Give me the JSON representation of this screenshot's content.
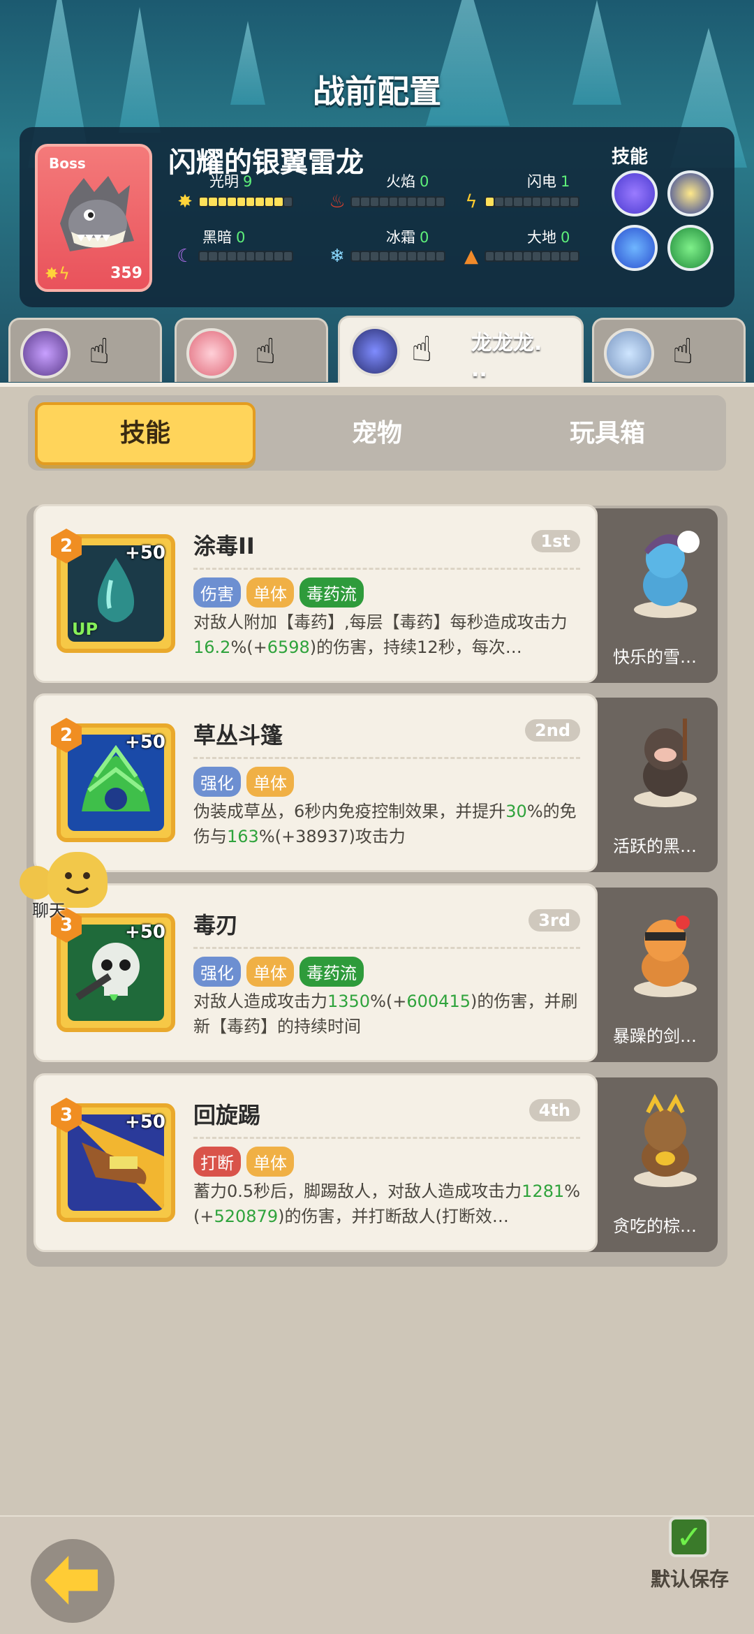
{
  "header": {
    "title": "战前配置"
  },
  "boss": {
    "tag": "Boss",
    "name": "闪耀的银翼雷龙",
    "level": "359",
    "elements": [
      {
        "label": "光明",
        "value": "9",
        "icon": "sun-icon",
        "filled": 9
      },
      {
        "label": "火焰",
        "value": "0",
        "icon": "fire-icon",
        "filled": 0
      },
      {
        "label": "闪电",
        "value": "1",
        "icon": "lightning-icon",
        "filled": 1
      },
      {
        "label": "黑暗",
        "value": "0",
        "icon": "moon-icon",
        "filled": 0
      },
      {
        "label": "冰霜",
        "value": "0",
        "icon": "snowflake-icon",
        "filled": 0
      },
      {
        "label": "大地",
        "value": "0",
        "icon": "earth-icon",
        "filled": 0
      }
    ],
    "skills_label": "技能"
  },
  "characters": [
    {
      "name": ""
    },
    {
      "name": ""
    },
    {
      "name": "龙龙龙.\n.."
    },
    {
      "name": ""
    }
  ],
  "tabs": [
    "技能",
    "宠物",
    "玩具箱"
  ],
  "skills": [
    {
      "level": "2",
      "plus": "+50",
      "up": "UP",
      "title": "涂毒II",
      "rank": "1st",
      "tags": [
        {
          "text": "伤害",
          "color": "#6d8fd1"
        },
        {
          "text": "单体",
          "color": "#f0b045"
        },
        {
          "text": "毒药流",
          "color": "#2e9b3b"
        }
      ],
      "desc_a": "对敌人附加【毒药】,每层【毒药】每秒造成攻击力",
      "desc_g1": "16.2",
      "desc_b": "%(+",
      "desc_g2": "6598",
      "desc_c": ")的伤害，持续12秒，每次…",
      "pet_name": "快乐的雪…"
    },
    {
      "level": "2",
      "plus": "+50",
      "up": "",
      "title": "草丛斗篷",
      "rank": "2nd",
      "tags": [
        {
          "text": "强化",
          "color": "#6d8fd1"
        },
        {
          "text": "单体",
          "color": "#f0b045"
        }
      ],
      "desc_a": "伪装成草丛，6秒内免疫控制效果，并提升",
      "desc_g1": "30",
      "desc_b": "%的免伤与",
      "desc_g2": "163",
      "desc_c": "%(+38937)攻击力",
      "pet_name": "活跃的黑…"
    },
    {
      "level": "3",
      "plus": "+50",
      "up": "",
      "title": "毒刃",
      "rank": "3rd",
      "tags": [
        {
          "text": "强化",
          "color": "#6d8fd1"
        },
        {
          "text": "单体",
          "color": "#f0b045"
        },
        {
          "text": "毒药流",
          "color": "#2e9b3b"
        }
      ],
      "desc_a": "对敌人造成攻击力",
      "desc_g1": "1350",
      "desc_b": "%(+",
      "desc_g2": "600415",
      "desc_c": ")的伤害，并刷新【毒药】的持续时间",
      "pet_name": "暴躁的剑…"
    },
    {
      "level": "3",
      "plus": "+50",
      "up": "",
      "title": "回旋踢",
      "rank": "4th",
      "tags": [
        {
          "text": "打断",
          "color": "#d9534a"
        },
        {
          "text": "单体",
          "color": "#f0b045"
        }
      ],
      "desc_a": "蓄力0.5秒后，脚踢敌人，对敌人造成攻击力",
      "desc_g1": "1281",
      "desc_b": "%(+",
      "desc_g2": "520879",
      "desc_c": ")的伤害，并打断敌人(打断效…",
      "pet_name": "贪吃的棕…"
    }
  ],
  "chat": {
    "label": "聊天"
  },
  "footer": {
    "save_label": "默认保存"
  }
}
